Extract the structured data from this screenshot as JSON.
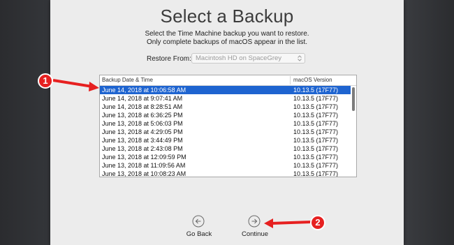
{
  "window": {
    "title": "Select a Backup",
    "subtitle_line1": "Select the Time Machine backup you want to restore.",
    "subtitle_line2": "Only complete backups of macOS appear in the list."
  },
  "restore_from": {
    "label": "Restore From:",
    "selected_value": "Macintosh HD on SpaceGrey"
  },
  "table": {
    "headers": [
      "Backup Date & Time",
      "macOS Version"
    ],
    "rows": [
      {
        "date": "June 14, 2018 at 10:06:58 AM",
        "version": "10.13.5 (17F77)",
        "selected": true
      },
      {
        "date": "June 14, 2018 at 9:07:41 AM",
        "version": "10.13.5 (17F77)"
      },
      {
        "date": "June 14, 2018 at 8:28:51 AM",
        "version": "10.13.5 (17F77)"
      },
      {
        "date": "June 13, 2018 at 6:36:25 PM",
        "version": "10.13.5 (17F77)"
      },
      {
        "date": "June 13, 2018 at 5:06:03 PM",
        "version": "10.13.5 (17F77)"
      },
      {
        "date": "June 13, 2018 at 4:29:05 PM",
        "version": "10.13.5 (17F77)"
      },
      {
        "date": "June 13, 2018 at 3:44:49 PM",
        "version": "10.13.5 (17F77)"
      },
      {
        "date": "June 13, 2018 at 2:43:08 PM",
        "version": "10.13.5 (17F77)"
      },
      {
        "date": "June 13, 2018 at 12:09:59 PM",
        "version": "10.13.5 (17F77)"
      },
      {
        "date": "June 13, 2018 at 11:09:56 AM",
        "version": "10.13.5 (17F77)"
      },
      {
        "date": "June 13, 2018 at 10:08:23 AM",
        "version": "10.13.5 (17F77)"
      }
    ]
  },
  "nav": {
    "back_label": "Go Back",
    "continue_label": "Continue",
    "back_icon": "arrow-left-circle-icon",
    "continue_icon": "arrow-right-circle-icon"
  },
  "annotations": {
    "callout1": "1",
    "callout2": "2",
    "color": "#e62020"
  },
  "colors": {
    "selection": "#1e64d0",
    "panel_bg": "#ececec",
    "backdrop": "#2a2b2e"
  }
}
